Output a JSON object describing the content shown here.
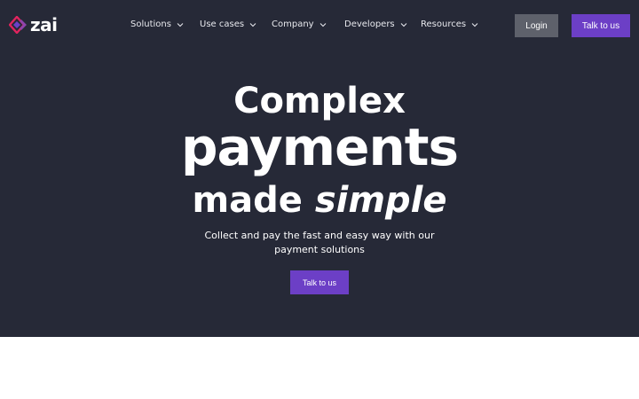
{
  "brand": {
    "name": "zai",
    "logo_icon": "zai-diamond-logo",
    "accent_color": "#6c3fc6",
    "logo_color": "#e0245e"
  },
  "nav": {
    "items": [
      {
        "label": "Solutions",
        "icon": "chevron-down-icon"
      },
      {
        "label": "Use cases",
        "icon": "chevron-down-icon"
      },
      {
        "label": "Company",
        "icon": "chevron-down-icon"
      },
      {
        "label": "Developers",
        "icon": "chevron-down-icon"
      },
      {
        "label": "Resources",
        "icon": "chevron-down-icon"
      }
    ],
    "login_label": "Login",
    "talk_label": "Talk to us"
  },
  "hero": {
    "line1": "Complex",
    "line2": "payments",
    "line3_plain": "made ",
    "line3_emphasis": "simple",
    "subtitle": "Collect and pay the fast and easy way with our payment solutions",
    "cta_label": "Talk to us",
    "background_color": "#262937"
  }
}
